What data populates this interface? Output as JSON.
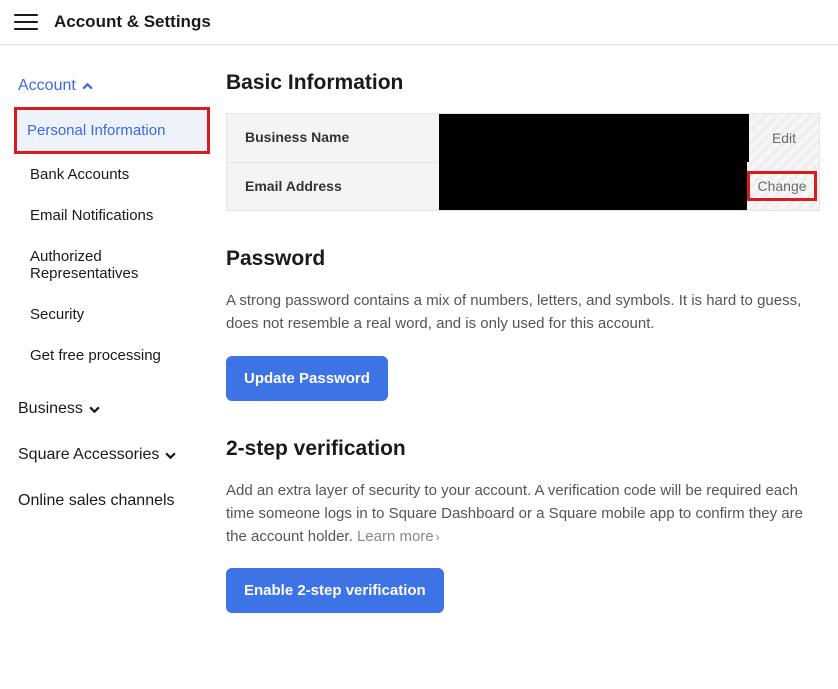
{
  "header": {
    "title": "Account & Settings"
  },
  "sidebar": {
    "account": {
      "label": "Account",
      "items": [
        {
          "label": "Personal Information"
        },
        {
          "label": "Bank Accounts"
        },
        {
          "label": "Email Notifications"
        },
        {
          "label": "Authorized Representatives"
        },
        {
          "label": "Security"
        },
        {
          "label": "Get free processing"
        }
      ]
    },
    "business": {
      "label": "Business"
    },
    "accessories": {
      "label": "Square Accessories"
    },
    "online_sales": {
      "label": "Online sales channels"
    }
  },
  "basic_info": {
    "title": "Basic Information",
    "rows": [
      {
        "label": "Business Name",
        "action": "Edit"
      },
      {
        "label": "Email Address",
        "action": "Change"
      }
    ]
  },
  "password": {
    "title": "Password",
    "body": "A strong password contains a mix of numbers, letters, and symbols. It is hard to guess, does not resemble a real word, and is only used for this account.",
    "button": "Update Password"
  },
  "two_step": {
    "title": "2-step verification",
    "body": "Add an extra layer of security to your account. A verification code will be required each time someone logs in to Square Dashboard or a Square mobile app to confirm they are the account holder. ",
    "learn_more": "Learn more",
    "button": "Enable 2-step verification"
  }
}
